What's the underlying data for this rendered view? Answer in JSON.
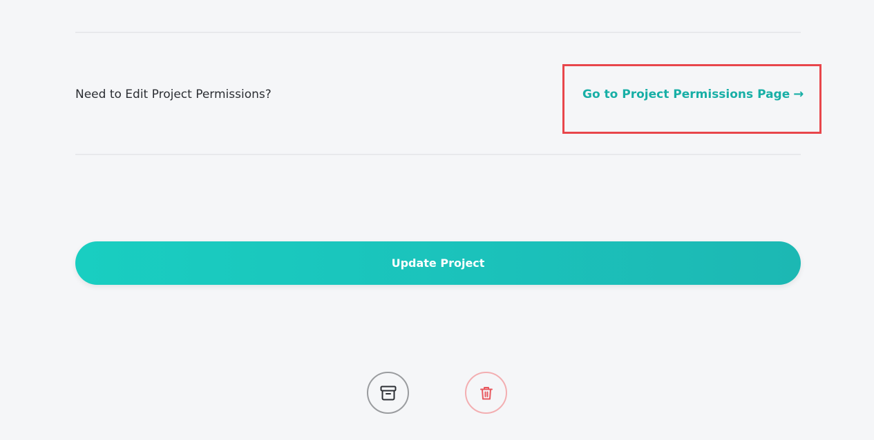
{
  "permissions": {
    "question": "Need to Edit Project Permissions?",
    "link_label": "Go to Project Permissions Page",
    "link_arrow": "→"
  },
  "actions": {
    "update_label": "Update Project",
    "archive_icon": "archive-box-icon",
    "delete_icon": "trash-icon"
  },
  "colors": {
    "accent": "#18afa6",
    "button_gradient_start": "#19cec1",
    "button_gradient_end": "#1cb8b3",
    "highlight": "#e8464b",
    "delete": "#e8585e"
  }
}
